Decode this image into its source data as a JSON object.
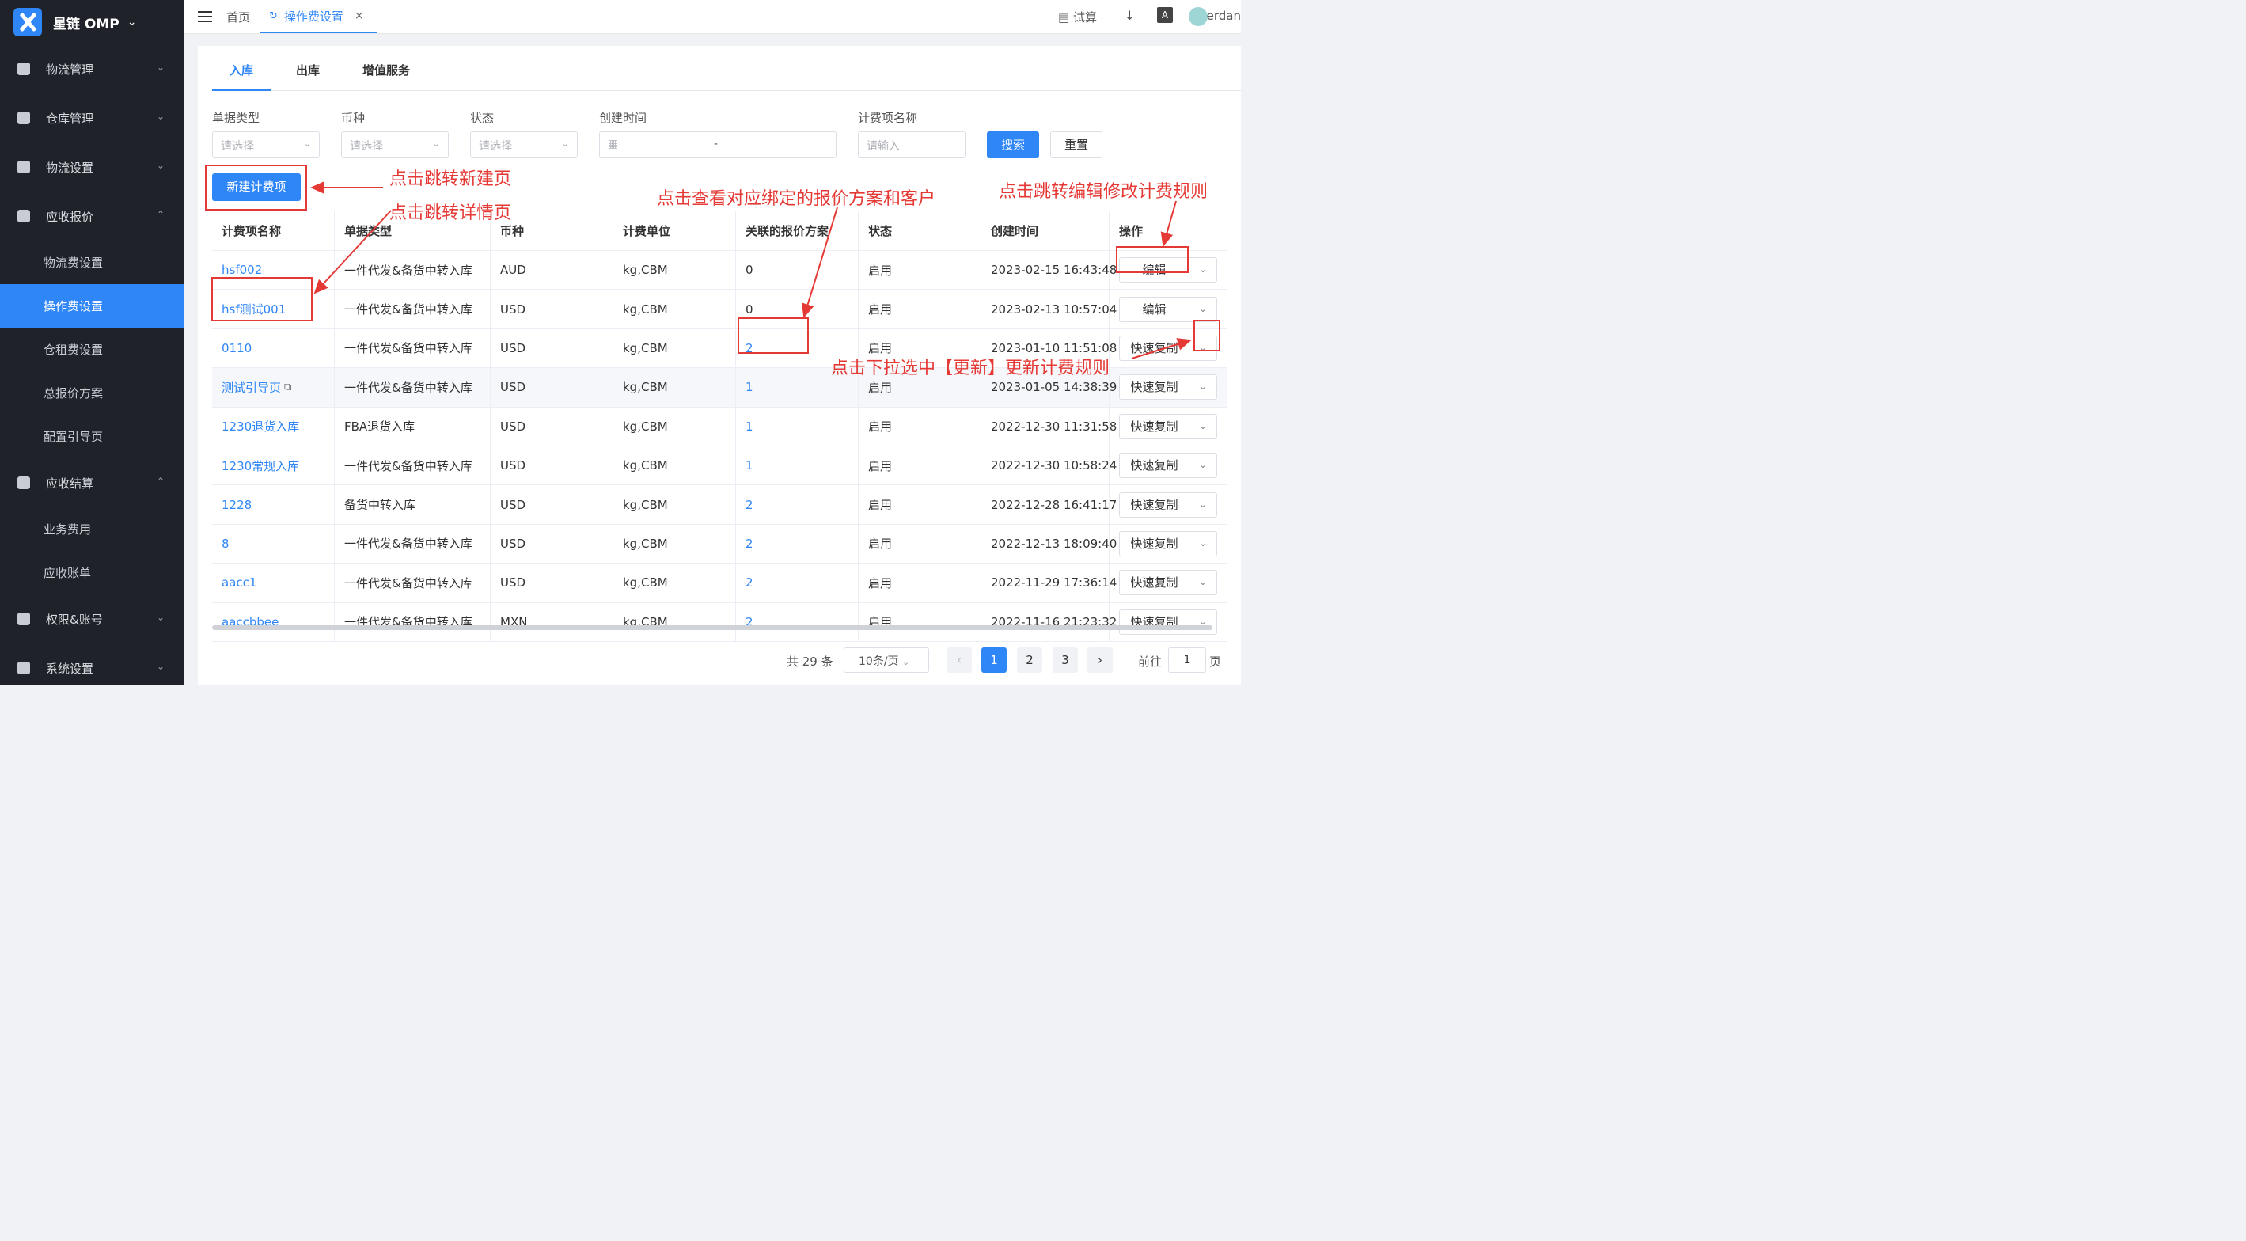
{
  "sidebar": {
    "brand": "星链  OMP",
    "groups": [
      {
        "label": "物流管理",
        "icon": "truck-icon"
      },
      {
        "label": "仓库管理",
        "icon": "warehouse-icon"
      },
      {
        "label": "物流设置",
        "icon": "settings-box-icon"
      },
      {
        "label": "应收报价",
        "icon": "price-tag-icon"
      },
      {
        "label": "应收结算",
        "icon": "clipboard-icon"
      },
      {
        "label": "权限&账号",
        "icon": "shield-icon"
      },
      {
        "label": "系统设置",
        "icon": "gear-icon"
      }
    ],
    "quote_items": [
      "物流费设置",
      "操作费设置",
      "仓租费设置",
      "总报价方案",
      "配置引导页"
    ],
    "settlement_items": [
      "业务费用",
      "应收账单"
    ],
    "active_item": "操作费设置",
    "active_color": "#2f86f6"
  },
  "topbar": {
    "home_tab": "首页",
    "active_tab": "操作费设置",
    "calc_label": "试算",
    "translate_label": "A",
    "user": "erdan"
  },
  "tabs": {
    "inbound": "入库",
    "outbound": "出库",
    "value_added": "增值服务"
  },
  "filters": {
    "doc_type": {
      "label": "单据类型",
      "placeholder": "请选择"
    },
    "currency": {
      "label": "币种",
      "placeholder": "请选择"
    },
    "status": {
      "label": "状态",
      "placeholder": "请选择"
    },
    "created": {
      "label": "创建时间",
      "separator": "-"
    },
    "fee_name": {
      "label": "计费项名称",
      "placeholder": "请输入"
    },
    "search_label": "搜索",
    "reset_label": "重置"
  },
  "new_button": "新建计费项",
  "table": {
    "headers": [
      "计费项名称",
      "单据类型",
      "币种",
      "计费单位",
      "关联的报价方案",
      "状态",
      "创建时间",
      "操作"
    ],
    "rows": [
      {
        "name": "hsf002",
        "doc_type": "一件代发&备货中转入库",
        "currency": "AUD",
        "unit": "kg,CBM",
        "plans": "0",
        "status": "启用",
        "created": "2023-02-15 16:43:48",
        "action": "编辑"
      },
      {
        "name": "hsf测试001",
        "doc_type": "一件代发&备货中转入库",
        "currency": "USD",
        "unit": "kg,CBM",
        "plans": "0",
        "status": "启用",
        "created": "2023-02-13 10:57:04",
        "action": "编辑"
      },
      {
        "name": "0110",
        "doc_type": "一件代发&备货中转入库",
        "currency": "USD",
        "unit": "kg,CBM",
        "plans": "2",
        "status": "启用",
        "created": "2023-01-10 11:51:08",
        "action": "快速复制"
      },
      {
        "name": "测试引导页",
        "doc_type": "一件代发&备货中转入库",
        "currency": "USD",
        "unit": "kg,CBM",
        "plans": "1",
        "status": "启用",
        "created": "2023-01-05 14:38:39",
        "action": "快速复制"
      },
      {
        "name": "1230退货入库",
        "doc_type": "FBA退货入库",
        "currency": "USD",
        "unit": "kg,CBM",
        "plans": "1",
        "status": "启用",
        "created": "2022-12-30 11:31:58",
        "action": "快速复制"
      },
      {
        "name": "1230常规入库",
        "doc_type": "一件代发&备货中转入库",
        "currency": "USD",
        "unit": "kg,CBM",
        "plans": "1",
        "status": "启用",
        "created": "2022-12-30 10:58:24",
        "action": "快速复制"
      },
      {
        "name": "1228",
        "doc_type": "备货中转入库",
        "currency": "USD",
        "unit": "kg,CBM",
        "plans": "2",
        "status": "启用",
        "created": "2022-12-28 16:41:17",
        "action": "快速复制"
      },
      {
        "name": "8",
        "doc_type": "一件代发&备货中转入库",
        "currency": "USD",
        "unit": "kg,CBM",
        "plans": "2",
        "status": "启用",
        "created": "2022-12-13 18:09:40",
        "action": "快速复制"
      },
      {
        "name": "aacc1",
        "doc_type": "一件代发&备货中转入库",
        "currency": "USD",
        "unit": "kg,CBM",
        "plans": "2",
        "status": "启用",
        "created": "2022-11-29 17:36:14",
        "action": "快速复制"
      },
      {
        "name": "aaccbbee",
        "doc_type": "一件代发&备货中转入库",
        "currency": "MXN",
        "unit": "kg,CBM",
        "plans": "2",
        "status": "启用",
        "created": "2022-11-16 21:23:32",
        "action": "快速复制"
      }
    ]
  },
  "pagination": {
    "total": "共 29 条",
    "page_size": "10条/页",
    "pages": [
      "1",
      "2",
      "3"
    ],
    "current": "1",
    "goto_label": "前往",
    "goto_value": "1",
    "page_suffix": "页"
  },
  "annotations": {
    "new_page": "点击跳转新建页",
    "detail_page": "点击跳转详情页",
    "view_plans": "点击查看对应绑定的报价方案和客户",
    "edit_rule": "点击跳转编辑修改计费规则",
    "update_rule": "点击下拉选中【更新】更新计费规则"
  },
  "colors": {
    "annotation": "#e53935",
    "primary": "#2f86f6",
    "sidebar": "#1f2228"
  }
}
